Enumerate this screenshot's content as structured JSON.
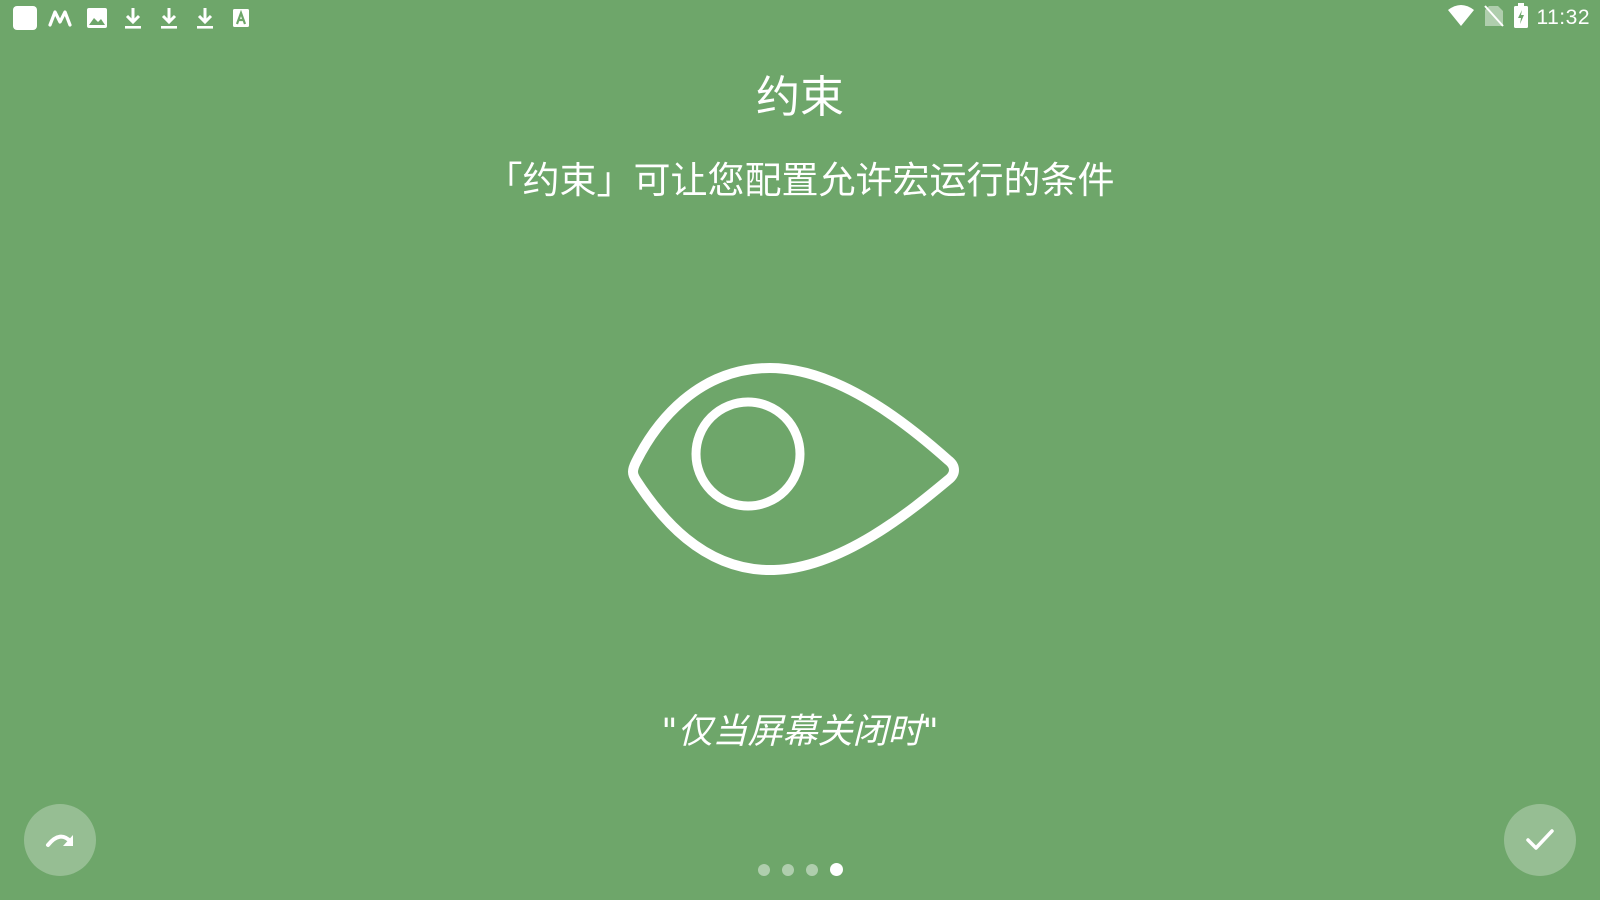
{
  "status_bar": {
    "left_icons": [
      "app-square-icon",
      "m-logo-icon",
      "image-icon",
      "download-icon",
      "download-icon",
      "download-icon",
      "font-a-icon"
    ],
    "right_icons": [
      "wifi-icon",
      "no-sim-icon",
      "battery-charging-icon"
    ],
    "time": "11:32"
  },
  "page": {
    "title": "约束",
    "subtitle": "「约束」可让您配置允许宏运行的条件",
    "hero_icon": "eye-icon",
    "example": "\"仅当屏幕关闭时\""
  },
  "pager": {
    "total": 4,
    "current": 4
  },
  "buttons": {
    "skip_icon": "redo-arrow-icon",
    "done_icon": "check-icon"
  },
  "colors": {
    "background": "#6ea66a",
    "foreground": "#ffffff"
  }
}
